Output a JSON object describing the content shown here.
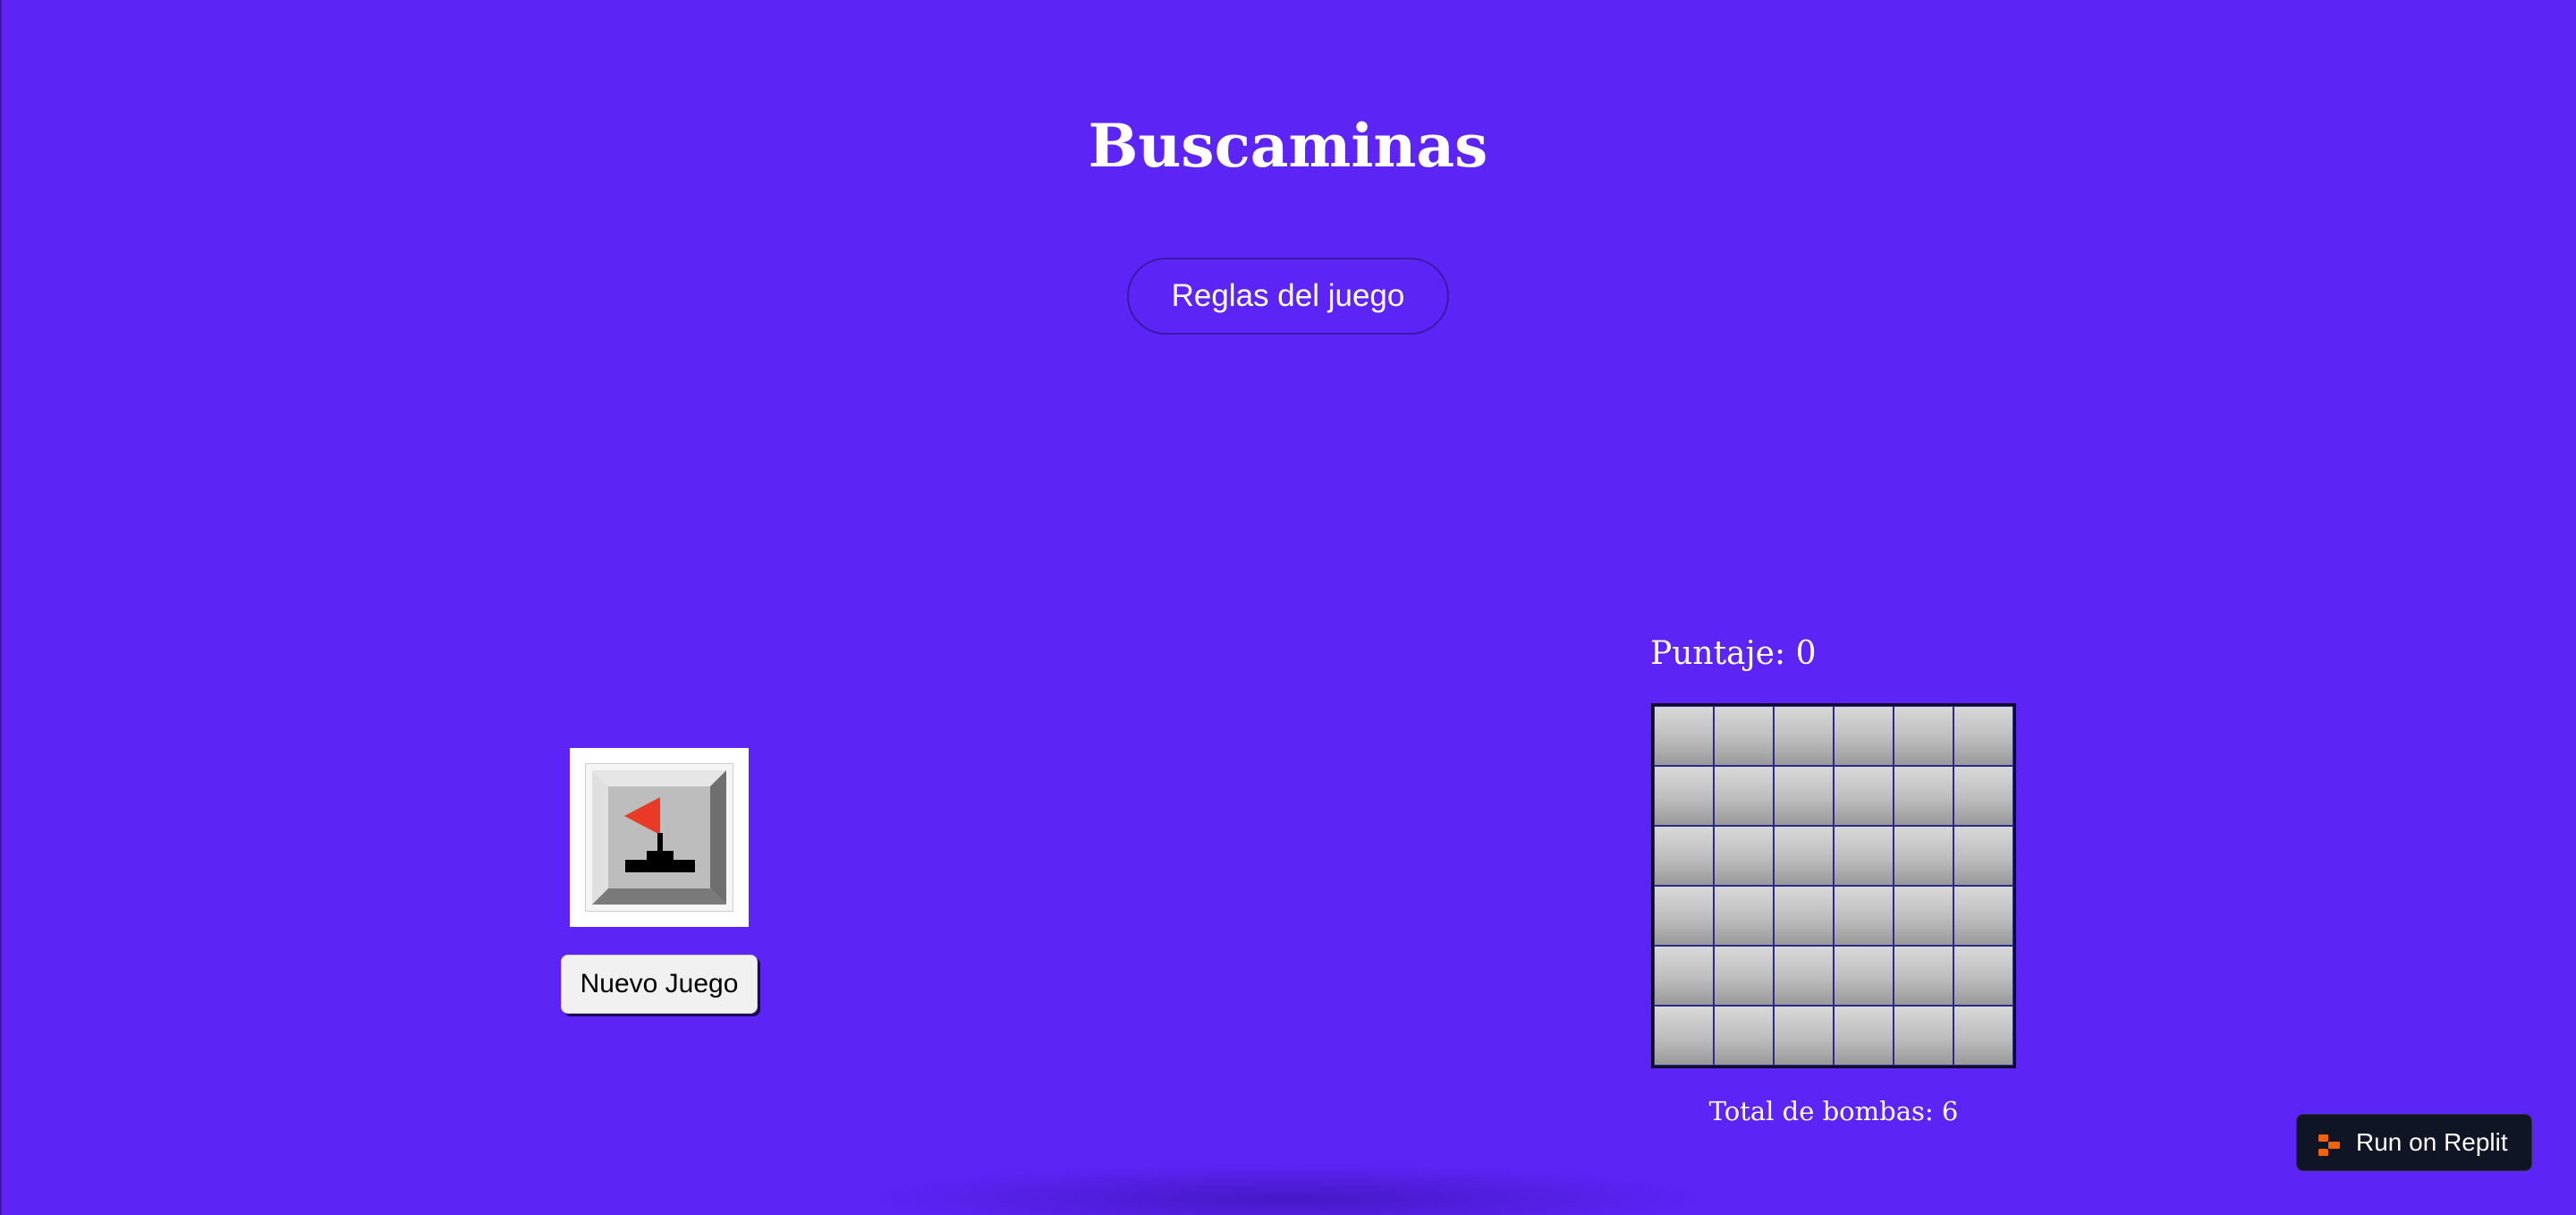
{
  "app": {
    "title": "Buscaminas"
  },
  "header": {
    "rules_button_label": "Reglas del juego"
  },
  "controls": {
    "logo_icon": "minesweeper-flag-icon",
    "new_game_label": "Nuevo Juego"
  },
  "score": {
    "label": "Puntaje:",
    "value": "0"
  },
  "board": {
    "rows": 6,
    "cols": 6,
    "cells_state": "all-covered"
  },
  "bombs": {
    "label": "Total de bombas:",
    "value": "6"
  },
  "replit": {
    "icon": "replit-logo-icon",
    "label": "Run on Replit"
  },
  "colors": {
    "background": "#5d24f6",
    "text": "#ffffff",
    "flag": "#e83a24",
    "replit_accent": "#f26207",
    "replit_bg": "#0f1524"
  }
}
